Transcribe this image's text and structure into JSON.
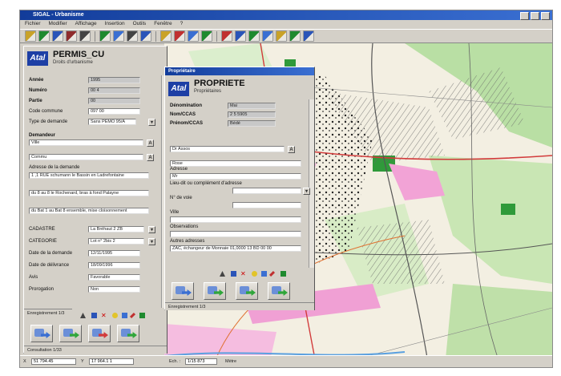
{
  "window": {
    "title": "SIGAL - Urbanisme"
  },
  "menu": [
    "Fichier",
    "Modifier",
    "Affichage",
    "Insertion",
    "Outils",
    "Fenêtre",
    "?"
  ],
  "toolbar_icon_colors": [
    "#c9a227",
    "#1f8a2f",
    "#2a54b8",
    "#8f2c2c",
    "#444444",
    "#1f8a2f",
    "#3a6fd2",
    "#444444",
    "#2a54b8",
    "#c9a227",
    "#c03030",
    "#3a6fd2",
    "#1f8a2f",
    "#c03030",
    "#2a54b8",
    "#1f8a2f",
    "#3a6fd2",
    "#c9a227",
    "#1f8a2f",
    "#2a54b8"
  ],
  "left_panel": {
    "logo": "Atal",
    "title": "PERMIS_CU",
    "subtitle": "Droits d'urbanisme",
    "fields": [
      {
        "label": "Année",
        "value": "1995"
      },
      {
        "label": "Numéro",
        "value": "00 4"
      },
      {
        "label": "Partie",
        "value": "00"
      },
      {
        "label": "Code commune",
        "value": "097 00"
      },
      {
        "label": "Type de demande",
        "value": "Sans PEMO 95/A"
      }
    ],
    "demandeur_label": "Demandeur",
    "demandeur_value": "Ville",
    "second_value": "Commu",
    "adresse_label": "Adresse de la demande",
    "adresse_lines": [
      "1 ,1 RUE schumann le Bassin en Ladrefontaine",
      "du 8 au 8 le Rochenard, bras à fond Palayne",
      "du Bat 1 au Bat 8 ensemble, mise cloisonnement"
    ],
    "lower_fields": [
      {
        "label": "CADASTRE",
        "value": "La Bréhaut 2 ZB"
      },
      {
        "label": "CATEGORIE",
        "value": "Lot n° 2bis 2"
      },
      {
        "label": "Date de la demande",
        "value": "12/11/1995"
      },
      {
        "label": "Date de délivrance",
        "value": "18/09/1996"
      },
      {
        "label": "Avis",
        "value": "Favorable"
      },
      {
        "label": "Prorogation",
        "value": "Non"
      }
    ],
    "record_nav": "Enregistrement 1/3",
    "footer_nav": "Consultation 1/33"
  },
  "right_panel": {
    "window_title": "Propriétaire",
    "logo": "Atal",
    "title": "PROPRIETE",
    "subtitle": "Propriétaires",
    "fields": [
      {
        "label": "Dénomination",
        "value": "Mai"
      },
      {
        "label": "Nom/CCAS",
        "value": "2 5 5905"
      },
      {
        "label": "Prénom/CCAS",
        "value": "Bédé"
      }
    ],
    "field_rows": [
      {
        "label": "",
        "value": "Dr Assos"
      },
      {
        "label": "",
        "value": "Rose"
      },
      {
        "label": "Adresse",
        "value": "Mr"
      },
      {
        "label": "Lieu-dit ou complément d'adresse",
        "value": ""
      },
      {
        "label": "N° de voie",
        "value": ""
      },
      {
        "label": "Ville",
        "value": ""
      },
      {
        "label": "Observations",
        "value": ""
      },
      {
        "label": "Autres adresses",
        "value": "ZAC, échangeur de Monnaie 01,0000 13 BD 00 00"
      }
    ],
    "record_nav": "Enregistrement 1/3"
  },
  "statusbar": {
    "x_value": "51 794.45",
    "y_value": "17 964.1 1",
    "scale_label": "Ech. :",
    "scale_value": "1/15 873",
    "unit_label": "Mètre"
  }
}
